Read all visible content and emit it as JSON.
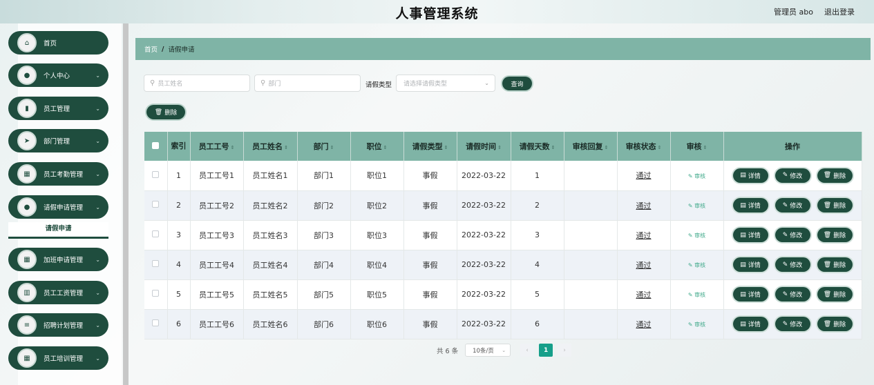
{
  "header": {
    "title": "人事管理系统",
    "user": "管理员 abo",
    "logout": "退出登录"
  },
  "sidebar": {
    "items": [
      {
        "label": "首页",
        "icon": "home-icon",
        "glyph": "⌂",
        "arrow": false
      },
      {
        "label": "个人中心",
        "icon": "user-icon",
        "glyph": "●",
        "arrow": true
      },
      {
        "label": "员工管理",
        "icon": "briefcase-icon",
        "glyph": "▮",
        "arrow": true
      },
      {
        "label": "部门管理",
        "icon": "send-icon",
        "glyph": "➤",
        "arrow": true
      },
      {
        "label": "员工考勤管理",
        "icon": "grid-icon",
        "glyph": "▦",
        "arrow": true
      },
      {
        "label": "请假申请管理",
        "icon": "person-icon",
        "glyph": "●",
        "arrow": true
      },
      {
        "label": "加班申请管理",
        "icon": "grid-icon",
        "glyph": "▦",
        "arrow": true
      },
      {
        "label": "员工工资管理",
        "icon": "bar-chart-icon",
        "glyph": "▥",
        "arrow": true
      },
      {
        "label": "招聘计划管理",
        "icon": "list-icon",
        "glyph": "≡",
        "arrow": true
      },
      {
        "label": "员工培训管理",
        "icon": "grid-icon",
        "glyph": "▦",
        "arrow": true
      }
    ],
    "submenu": {
      "label": "请假申请"
    }
  },
  "breadcrumb": {
    "home": "首页",
    "sep": "/",
    "current": "请假申请"
  },
  "filters": {
    "name_placeholder": "员工姓名",
    "dept_placeholder": "部门",
    "type_label": "请假类型",
    "type_placeholder": "请选择请假类型",
    "query_button": "查询",
    "delete_button": "删除"
  },
  "table": {
    "headers": [
      "索引",
      "员工工号",
      "员工姓名",
      "部门",
      "职位",
      "请假类型",
      "请假时间",
      "请假天数",
      "审核回复",
      "审核状态",
      "审核",
      "操作"
    ],
    "rows": [
      {
        "index": "1",
        "emp_no": "员工工号1",
        "name": "员工姓名1",
        "dept": "部门1",
        "position": "职位1",
        "type": "事假",
        "date": "2022-03-22",
        "days": "1",
        "reply": "",
        "status": "通过"
      },
      {
        "index": "2",
        "emp_no": "员工工号2",
        "name": "员工姓名2",
        "dept": "部门2",
        "position": "职位2",
        "type": "事假",
        "date": "2022-03-22",
        "days": "2",
        "reply": "",
        "status": "通过"
      },
      {
        "index": "3",
        "emp_no": "员工工号3",
        "name": "员工姓名3",
        "dept": "部门3",
        "position": "职位3",
        "type": "事假",
        "date": "2022-03-22",
        "days": "3",
        "reply": "",
        "status": "通过"
      },
      {
        "index": "4",
        "emp_no": "员工工号4",
        "name": "员工姓名4",
        "dept": "部门4",
        "position": "职位4",
        "type": "事假",
        "date": "2022-03-22",
        "days": "4",
        "reply": "",
        "status": "通过"
      },
      {
        "index": "5",
        "emp_no": "员工工号5",
        "name": "员工姓名5",
        "dept": "部门5",
        "position": "职位5",
        "type": "事假",
        "date": "2022-03-22",
        "days": "5",
        "reply": "",
        "status": "通过"
      },
      {
        "index": "6",
        "emp_no": "员工工号6",
        "name": "员工姓名6",
        "dept": "部门6",
        "position": "职位6",
        "type": "事假",
        "date": "2022-03-22",
        "days": "6",
        "reply": "",
        "status": "通过"
      }
    ],
    "audit_link": "审核",
    "op_detail": "详情",
    "op_edit": "修改",
    "op_delete": "删除"
  },
  "pagination": {
    "total": "共 6 条",
    "page_size": "10条/页",
    "current_page": "1",
    "prev": "‹",
    "next": "›"
  },
  "colors": {
    "accent": "#1f4d3e",
    "header_bg": "#7fb4a6",
    "row_alt": "#eef2f7",
    "active_page": "#169f8a"
  }
}
